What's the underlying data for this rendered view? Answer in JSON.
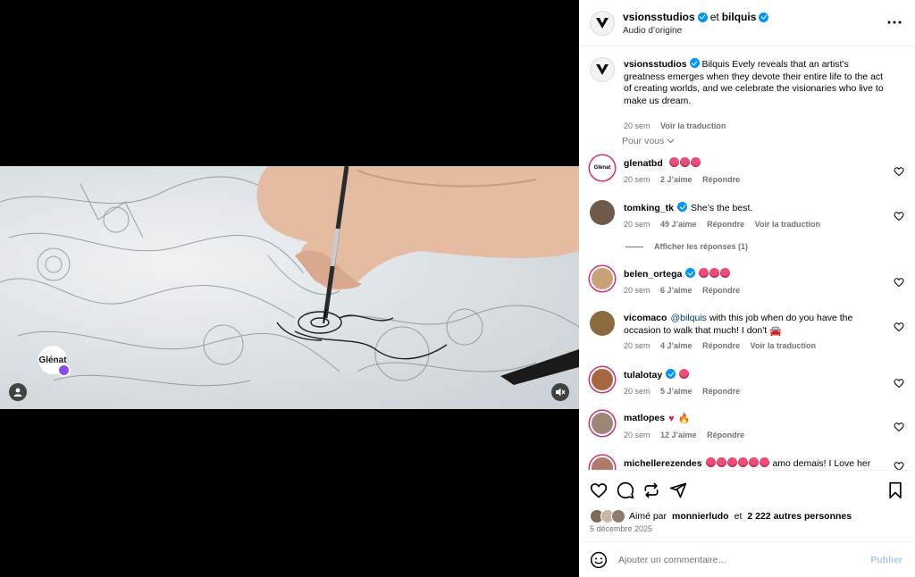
{
  "header": {
    "user1": "vsionsstudios",
    "joiner": "et",
    "user2": "bilquis",
    "subtitle": "Audio d’origine"
  },
  "caption": {
    "username": "vsionsstudios",
    "text": "Bilquis Evely reveals that an artist's greatness emerges when they devote their entire life to the act of creating worlds, and we celebrate the visionaries who live to make us dream.",
    "time": "20 sem",
    "translate": "Voir la traduction"
  },
  "pour_vous": "Pour vous",
  "video": {
    "overlay_avatar_text": "Glénat"
  },
  "comments": [
    {
      "username": "glenatbd",
      "text": "",
      "emojis": [
        "love",
        "love",
        "love"
      ],
      "time": "20 sem",
      "likes": "2 J’aime",
      "reply": "Répondre",
      "translate": ""
    },
    {
      "username": "tomking_tk",
      "text": "She’s the best.",
      "emojis": [],
      "time": "20 sem",
      "likes": "49 J’aime",
      "reply": "Répondre",
      "translate": "Voir la traduction",
      "replies": "Afficher les réponses (1)"
    },
    {
      "username": "belen_ortega",
      "text": "",
      "emojis": [
        "love",
        "love",
        "love"
      ],
      "time": "20 sem",
      "likes": "6 J’aime",
      "reply": "Répondre",
      "translate": ""
    },
    {
      "username": "vicomaco",
      "mention": "@bilquis",
      "text": "with this job when do you have the occasion to walk that much! I don't",
      "time": "20 sem",
      "likes": "4 J’aime",
      "reply": "Répondre",
      "translate": "Voir la traduction"
    },
    {
      "username": "tulalotay",
      "text": "",
      "emojis": [
        "love"
      ],
      "time": "20 sem",
      "likes": "5 J’aime",
      "reply": "Répondre",
      "translate": ""
    },
    {
      "username": "matlopes",
      "text": "",
      "time": "20 sem",
      "likes": "12 J’aime",
      "reply": "Répondre",
      "translate": ""
    },
    {
      "username": "michellerezendes",
      "text": "amo demais! I Love her",
      "emojis": [
        "love",
        "love",
        "love",
        "love",
        "love",
        "love"
      ]
    }
  ],
  "likes": {
    "prefix": "Aimé par",
    "user": "monnierludo",
    "joiner": "et",
    "count": "2 222 autres personnes"
  },
  "date": "5 décembre 2025",
  "comment_box": {
    "placeholder": "Ajouter un commentaire…",
    "publish": "Publier"
  },
  "colors": {
    "verified": "#0095f6",
    "link": "#00376b",
    "muted": "#737373",
    "publish_disabled": "#a8c9f5"
  }
}
